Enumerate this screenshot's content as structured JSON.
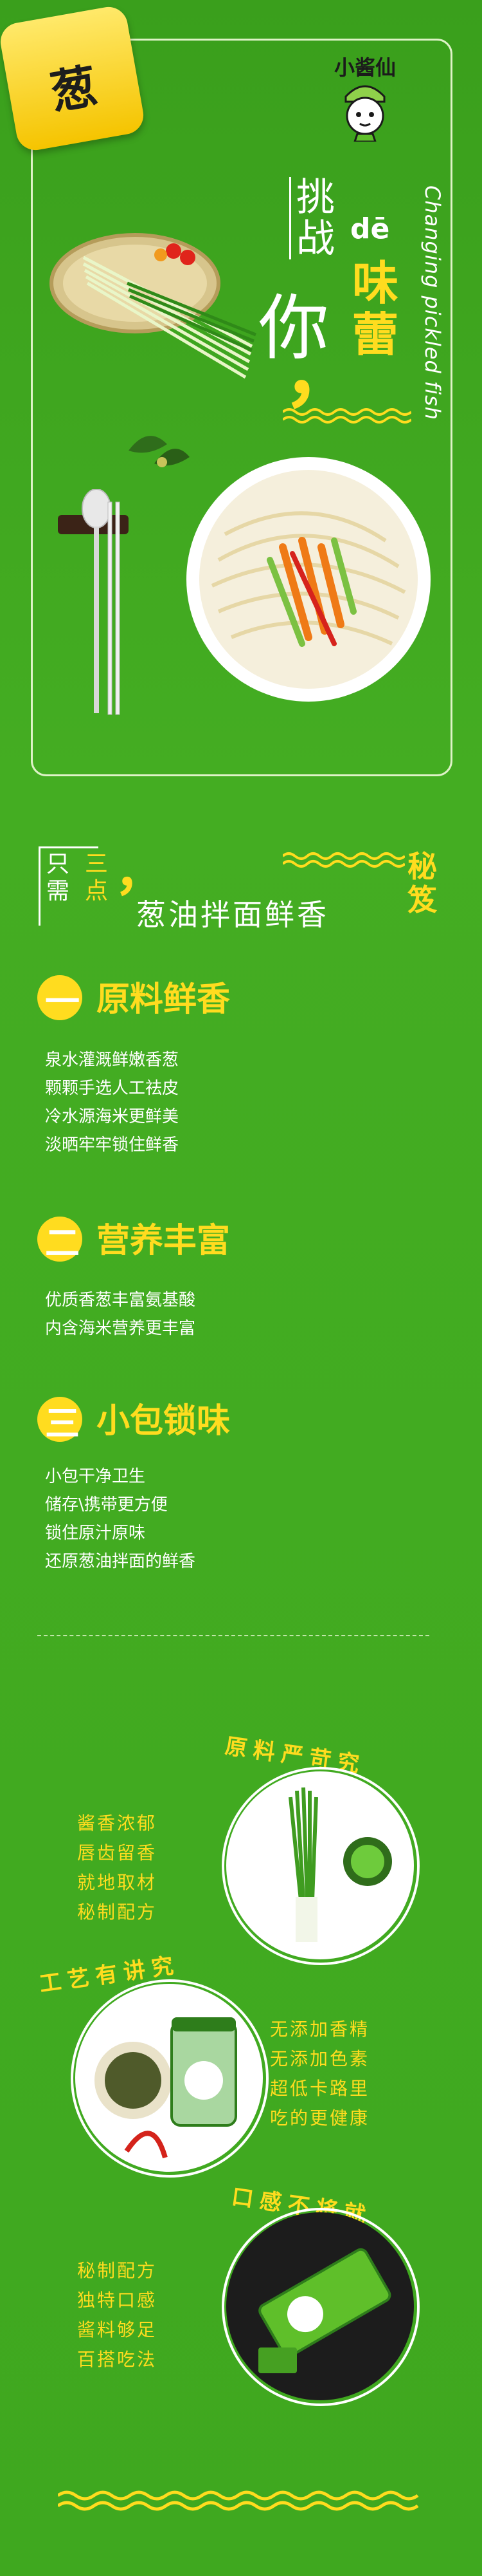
{
  "hero": {
    "badge_text": "葱",
    "brand_name": "小酱仙",
    "title_part1": "挑战",
    "title_pinyin": "dē",
    "title_part2": "你",
    "title_highlight": "味蕾",
    "title_comma": "，",
    "vertical_text": "Changing pickled fish"
  },
  "secret": {
    "prefix_a": "只需",
    "prefix_b": "三点",
    "comma": "，",
    "title": "葱油拌面鲜香",
    "suffix": "秘笈"
  },
  "features": [
    {
      "number": "一",
      "heading": "原料鲜香",
      "lines": [
        "泉水灌溉鲜嫩香葱",
        "颗颗手选人工祛皮",
        "冷水源海米更鲜美",
        "淡晒牢牢锁住鲜香"
      ]
    },
    {
      "number": "二",
      "heading": "营养丰富",
      "lines": [
        "优质香葱丰富氨基酸",
        "内含海米营养更丰富"
      ]
    },
    {
      "number": "三",
      "heading": "小包锁味",
      "lines": [
        "小包干净卫生",
        "储存\\携带更方便",
        "锁住原汁原味",
        "还原葱油拌面的鲜香"
      ]
    }
  ],
  "showcase": [
    {
      "arc_title": "原料严苛究",
      "lines": [
        "酱香浓郁",
        "唇齿留香",
        "就地取材",
        "秘制配方"
      ]
    },
    {
      "arc_title": "工艺有讲究",
      "lines": [
        "无添加香精",
        "无添加色素",
        "超低卡路里",
        "吃的更健康"
      ]
    },
    {
      "arc_title": "口感不将就",
      "lines": [
        "秘制配方",
        "独特口感",
        "酱料够足",
        "百搭吃法"
      ]
    }
  ],
  "colors": {
    "background": "#3ea41f",
    "accent_yellow": "#ffdc1f",
    "text_white": "#ffffff"
  }
}
